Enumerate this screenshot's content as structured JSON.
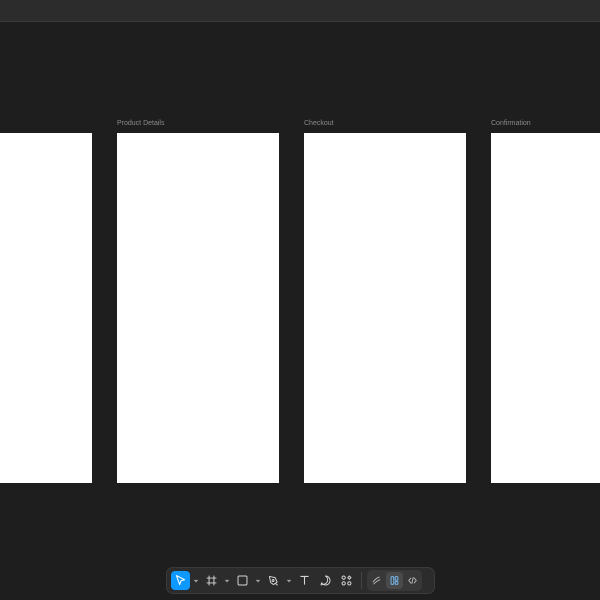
{
  "canvas": {
    "frames": [
      {
        "label": ""
      },
      {
        "label": "Product Details"
      },
      {
        "label": "Checkout"
      },
      {
        "label": "Confirmation"
      }
    ]
  },
  "toolbar": {
    "tools": [
      {
        "icon": "move-arrow-icon",
        "active": true,
        "has_menu": true
      },
      {
        "icon": "frame-hash-icon",
        "active": false,
        "has_menu": true
      },
      {
        "icon": "rectangle-icon",
        "active": false,
        "has_menu": true
      },
      {
        "icon": "pen-icon",
        "active": false,
        "has_menu": true
      },
      {
        "icon": "text-icon",
        "active": false,
        "has_menu": false
      },
      {
        "icon": "comment-icon",
        "active": false,
        "has_menu": false
      },
      {
        "icon": "actions-icon",
        "active": false,
        "has_menu": false
      }
    ],
    "modes": [
      {
        "icon": "draw-mode-icon",
        "active": false
      },
      {
        "icon": "design-mode-icon",
        "active": true
      },
      {
        "icon": "dev-mode-icon",
        "active": false
      }
    ],
    "accent_color": "#0d99ff"
  }
}
